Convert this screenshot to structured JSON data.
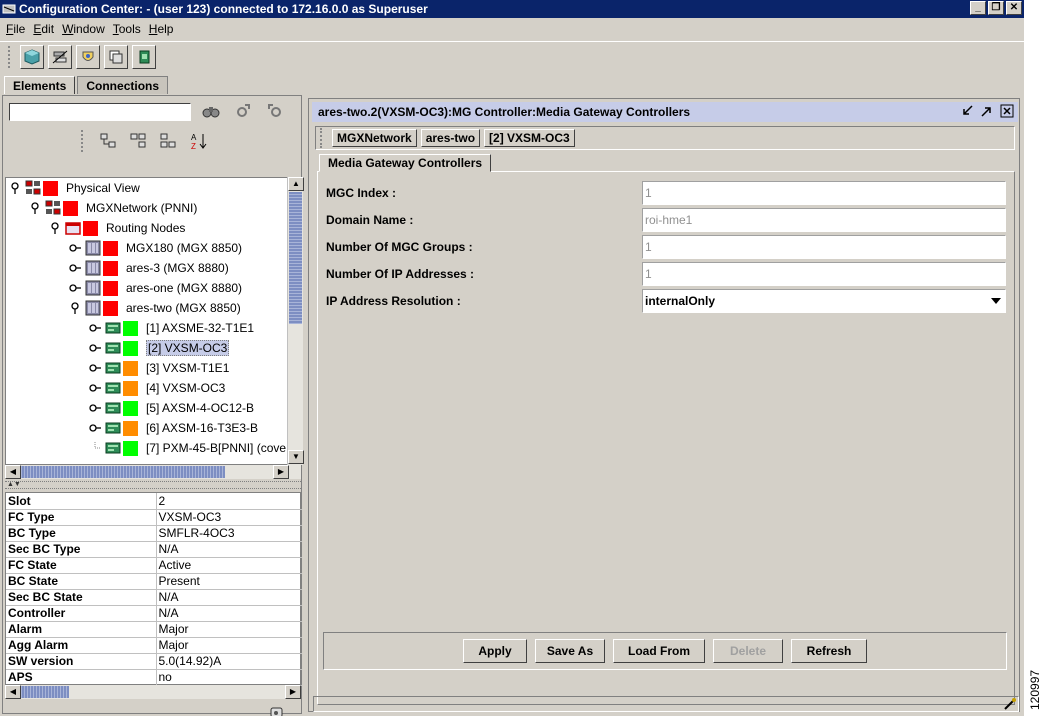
{
  "window": {
    "title": "Configuration Center: - (user 123) connected to 172.16.0.0 as Superuser",
    "minimize": "_",
    "maximize": "❐",
    "close": "✕"
  },
  "menubar": [
    {
      "first": "F",
      "rest": "ile"
    },
    {
      "first": "E",
      "rest": "dit"
    },
    {
      "first": "W",
      "rest": "indow"
    },
    {
      "first": "T",
      "rest": "ools"
    },
    {
      "first": "H",
      "rest": "elp"
    }
  ],
  "toolbar": {
    "icons": [
      "cube-icon",
      "network-icon",
      "shield-icon",
      "window-icon",
      "document-icon"
    ]
  },
  "tabs": {
    "elements": "Elements",
    "connections": "Connections"
  },
  "search": {
    "value": "",
    "tools": [
      "binoculars-icon",
      "find-next-icon",
      "find-prev-icon"
    ]
  },
  "view_tools": [
    "tree-view-icon",
    "tree-expand-icon",
    "tree-collapse-icon",
    "sort-az-icon"
  ],
  "tree": [
    {
      "label": "Physical View",
      "status": "#ff0000",
      "selected": false
    },
    {
      "label": "MGXNetwork (PNNI)",
      "status": "#ff0000",
      "selected": false
    },
    {
      "label": "Routing Nodes",
      "status": "#ff0000",
      "selected": false
    },
    {
      "label": "MGX180 (MGX 8850)",
      "status": "#ff0000",
      "selected": false
    },
    {
      "label": "ares-3 (MGX 8880)",
      "status": "#ff0000",
      "selected": false
    },
    {
      "label": "ares-one (MGX 8880)",
      "status": "#ff0000",
      "selected": false
    },
    {
      "label": "ares-two (MGX 8850)",
      "status": "#ff0000",
      "selected": false
    },
    {
      "label": "[1] AXSME-32-T1E1",
      "status": "#00ff00",
      "selected": false
    },
    {
      "label": "[2] VXSM-OC3",
      "status": "#00ff00",
      "selected": true
    },
    {
      "label": "[3] VXSM-T1E1",
      "status": "#ff8c00",
      "selected": false
    },
    {
      "label": "[4] VXSM-OC3",
      "status": "#ff8c00",
      "selected": false
    },
    {
      "label": "[5] AXSM-4-OC12-B",
      "status": "#00ff00",
      "selected": false
    },
    {
      "label": "[6] AXSM-16-T3E3-B",
      "status": "#ff8c00",
      "selected": false
    },
    {
      "label": "[7] PXM-45-B[PNNI] (cove",
      "status": "#00ff00",
      "selected": false
    }
  ],
  "properties": [
    {
      "key": "Slot",
      "value": "2"
    },
    {
      "key": "FC Type",
      "value": "VXSM-OC3"
    },
    {
      "key": "BC Type",
      "value": "SMFLR-4OC3"
    },
    {
      "key": "Sec BC Type",
      "value": "N/A"
    },
    {
      "key": "FC State",
      "value": "Active"
    },
    {
      "key": "BC State",
      "value": "Present"
    },
    {
      "key": "Sec BC State",
      "value": "N/A"
    },
    {
      "key": "Controller",
      "value": "N/A"
    },
    {
      "key": "Alarm",
      "value": "Major"
    },
    {
      "key": "Agg Alarm",
      "value": "Major"
    },
    {
      "key": "SW version",
      "value": "5.0(14.92)A"
    },
    {
      "key": "APS",
      "value": "no"
    }
  ],
  "right": {
    "title": "ares-two.2(VXSM-OC3):MG Controller:Media Gateway Controllers",
    "breadcrumb": [
      "MGXNetwork",
      "ares-two",
      "[2] VXSM-OC3"
    ],
    "subtab": "Media Gateway Controllers",
    "form": [
      {
        "label": "MGC Index :",
        "value": "1",
        "type": "text"
      },
      {
        "label": "Domain Name :",
        "value": "roi-hme1",
        "type": "text"
      },
      {
        "label": "Number Of MGC Groups :",
        "value": "1",
        "type": "text"
      },
      {
        "label": "Number Of IP Addresses :",
        "value": "1",
        "type": "text"
      },
      {
        "label": "IP Address Resolution :",
        "value": "internalOnly",
        "type": "select"
      }
    ],
    "buttons": [
      {
        "label": "Apply",
        "disabled": false
      },
      {
        "label": "Save As",
        "disabled": false
      },
      {
        "label": "Load From",
        "disabled": false
      },
      {
        "label": "Delete",
        "disabled": true
      },
      {
        "label": "Refresh",
        "disabled": false
      }
    ]
  },
  "figure_number": "120997"
}
